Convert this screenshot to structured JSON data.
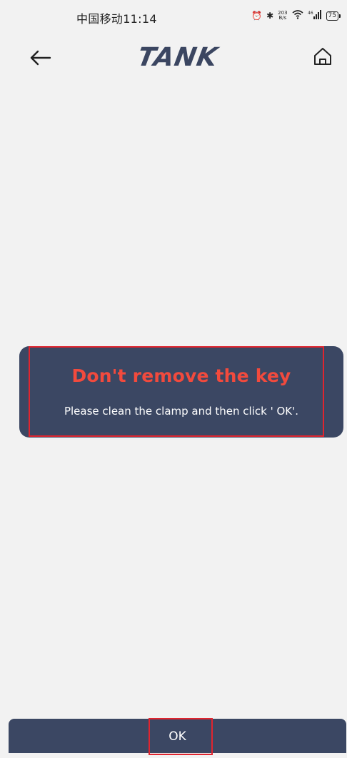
{
  "status_bar": {
    "carrier_time": "中国移动11:14",
    "speed_value": "203",
    "speed_unit": "B/s",
    "battery": "75"
  },
  "header": {
    "logo_text": "TANK"
  },
  "dialog": {
    "title": "Don't remove the key",
    "message": "Please clean the clamp and then click ' OK'."
  },
  "footer": {
    "ok_label": "OK"
  },
  "colors": {
    "background": "#f2f2f2",
    "panel": "#3b4763",
    "title_red": "#f24a3d",
    "highlight_red": "#e0252f"
  }
}
